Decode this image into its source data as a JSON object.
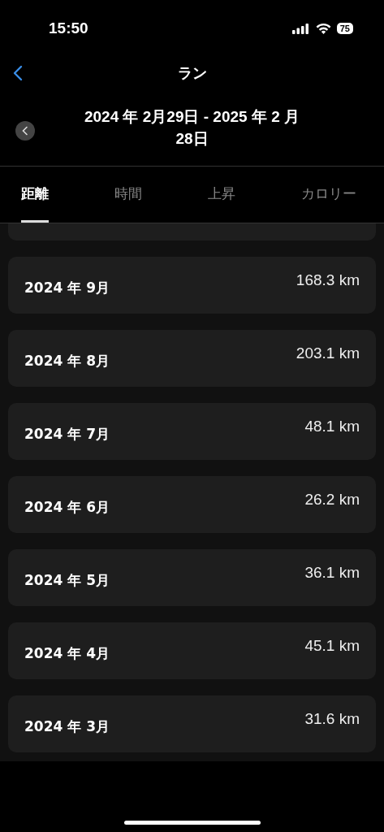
{
  "status_bar": {
    "time": "15:50",
    "battery": "75"
  },
  "nav": {
    "title": "ラン"
  },
  "date_range": {
    "text": "2024 年 2月29日 - 2025 年 2 月28日"
  },
  "tabs": [
    {
      "label": "距離",
      "selected": true
    },
    {
      "label": "時間",
      "selected": false
    },
    {
      "label": "上昇",
      "selected": false
    },
    {
      "label": "カロリー",
      "selected": false
    }
  ],
  "rows": [
    {
      "month": "2024 年 9月",
      "value": "168.3 km"
    },
    {
      "month": "2024 年 8月",
      "value": "203.1 km"
    },
    {
      "month": "2024 年 7月",
      "value": "48.1 km"
    },
    {
      "month": "2024 年 6月",
      "value": "26.2 km"
    },
    {
      "month": "2024 年 5月",
      "value": "36.1 km"
    },
    {
      "month": "2024 年 4月",
      "value": "45.1 km"
    },
    {
      "month": "2024 年 3月",
      "value": "31.6 km"
    }
  ]
}
